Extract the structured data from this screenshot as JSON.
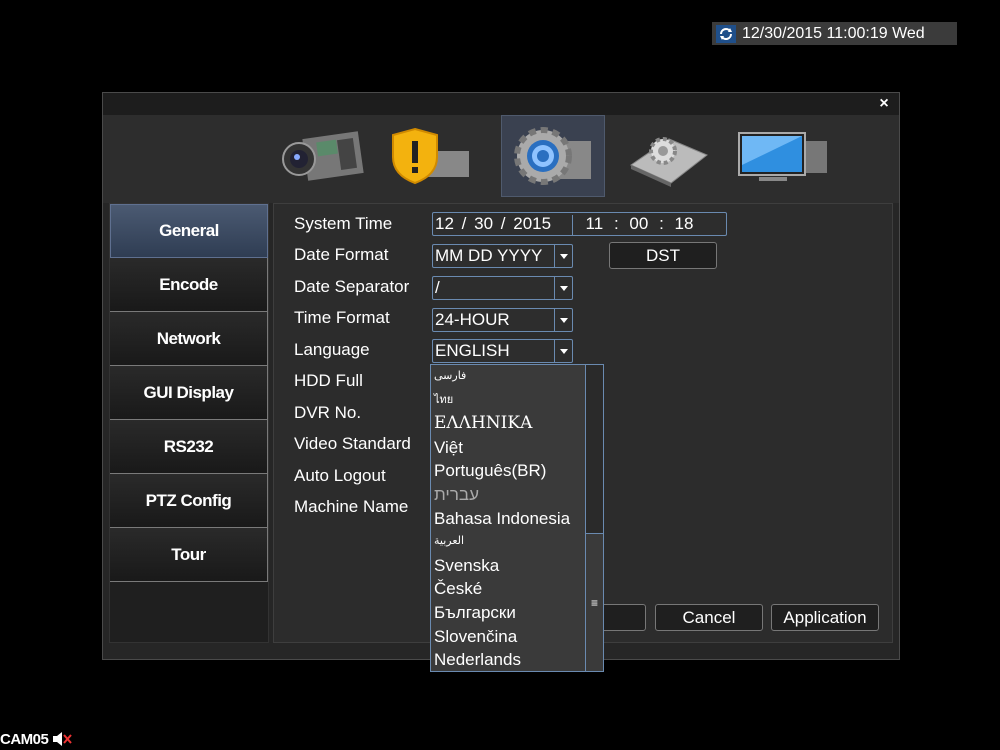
{
  "clock": {
    "text": "12/30/2015 11:00:19 Wed",
    "icon": "sync-icon"
  },
  "camera": {
    "name": "CAM05",
    "icon": "speaker-mute-icon"
  },
  "dialog": {
    "close_label": "×",
    "toolbar": [
      {
        "name": "record-icon"
      },
      {
        "name": "alarm-icon"
      },
      {
        "name": "system-settings-icon",
        "active": true
      },
      {
        "name": "advanced-settings-icon"
      },
      {
        "name": "system-info-icon"
      }
    ],
    "sidebar": [
      "General",
      "Encode",
      "Network",
      "GUI Display",
      "RS232",
      "PTZ Config",
      "Tour"
    ],
    "sidebar_active": "General",
    "labels": {
      "system_time": "System Time",
      "date_format": "Date Format",
      "date_separator": "Date Separator",
      "time_format": "Time Format",
      "language": "Language",
      "hdd_full": "HDD Full",
      "dvr_no": "DVR No.",
      "video_standard": "Video Standard",
      "auto_logout": "Auto Logout",
      "machine_name": "Machine Name"
    },
    "values": {
      "month": "12",
      "day": "30",
      "year": "2015",
      "sep": "/",
      "hour": "11",
      "minute": "00",
      "second": "18",
      "time_sep": ":",
      "date_format": "MM DD YYYY",
      "date_separator": "/",
      "time_format": "24-HOUR",
      "language": "ENGLISH"
    },
    "buttons": {
      "dst": "DST",
      "cancel": "Cancel",
      "application": "Application"
    },
    "language_options": [
      "فارسی",
      "ไทย",
      "ΕΛΛΗΝΙΚΑ",
      "Việt",
      "Português(BR)",
      "עברית",
      "Bahasa Indonesia",
      "العربية",
      "Svenska",
      "České",
      "Български",
      "Slovenčina",
      "Nederlands"
    ],
    "scrollbar_grip": "≡"
  }
}
